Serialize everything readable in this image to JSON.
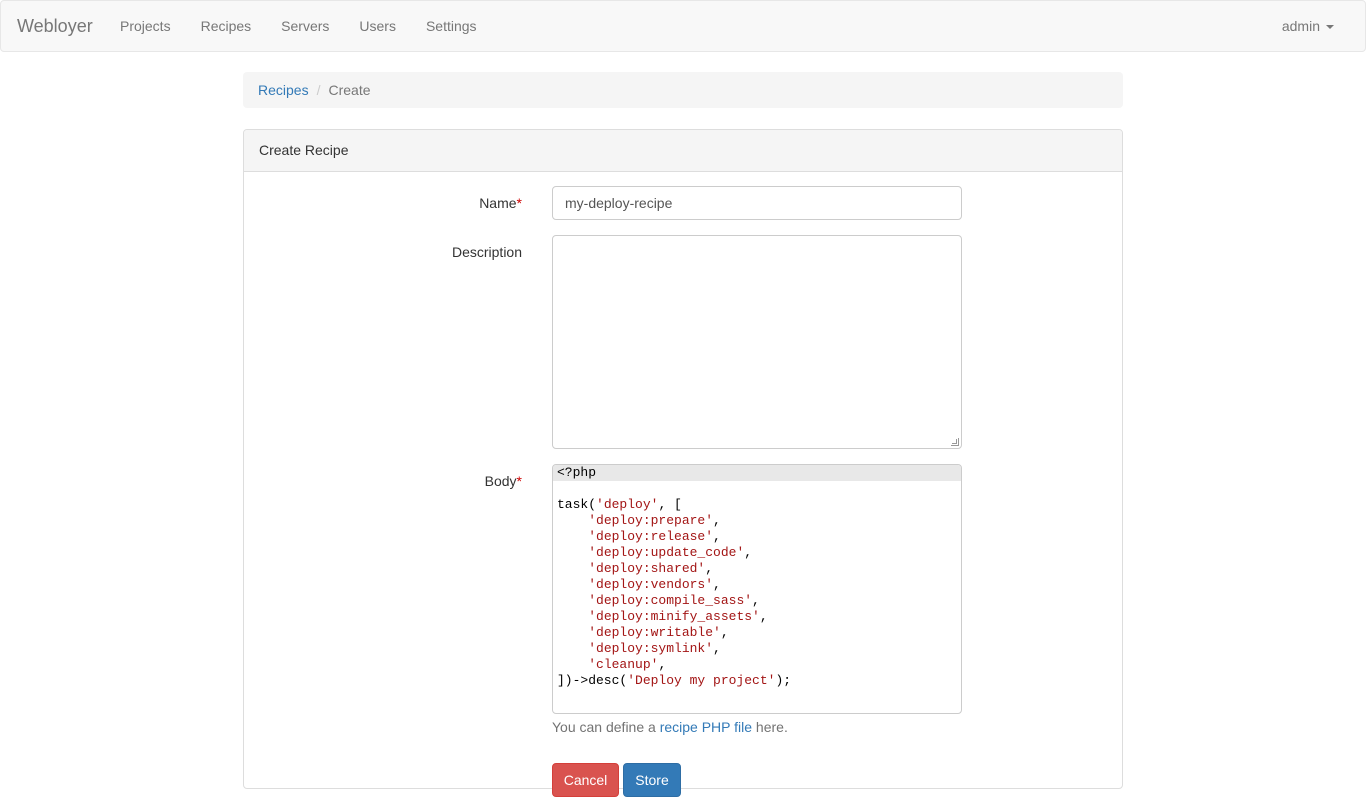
{
  "navbar": {
    "brand": "Webloyer",
    "items": [
      {
        "label": "Projects"
      },
      {
        "label": "Recipes"
      },
      {
        "label": "Servers"
      },
      {
        "label": "Users"
      },
      {
        "label": "Settings"
      }
    ],
    "user": "admin"
  },
  "breadcrumb": {
    "parent": "Recipes",
    "separator": "/",
    "current": "Create"
  },
  "panel": {
    "title": "Create Recipe"
  },
  "form": {
    "name": {
      "label": "Name",
      "required_mark": "*",
      "value": "my-deploy-recipe"
    },
    "description": {
      "label": "Description",
      "value": ""
    },
    "body": {
      "label": "Body",
      "required_mark": "*",
      "lines": [
        "<?php",
        "",
        "task('deploy', [",
        "    'deploy:prepare',",
        "    'deploy:release',",
        "    'deploy:update_code',",
        "    'deploy:shared',",
        "    'deploy:vendors',",
        "    'deploy:compile_sass',",
        "    'deploy:minify_assets',",
        "    'deploy:writable',",
        "    'deploy:symlink',",
        "    'cleanup',",
        "])->desc('Deploy my project');"
      ]
    },
    "help": {
      "before": "You can define a ",
      "link": "recipe PHP file",
      "after": " here."
    },
    "buttons": {
      "cancel": "Cancel",
      "store": "Store"
    }
  },
  "colors": {
    "link": "#337ab7",
    "required": "#cc0000",
    "danger": "#d9534f",
    "primary": "#337ab7",
    "code_string": "#a31515"
  }
}
